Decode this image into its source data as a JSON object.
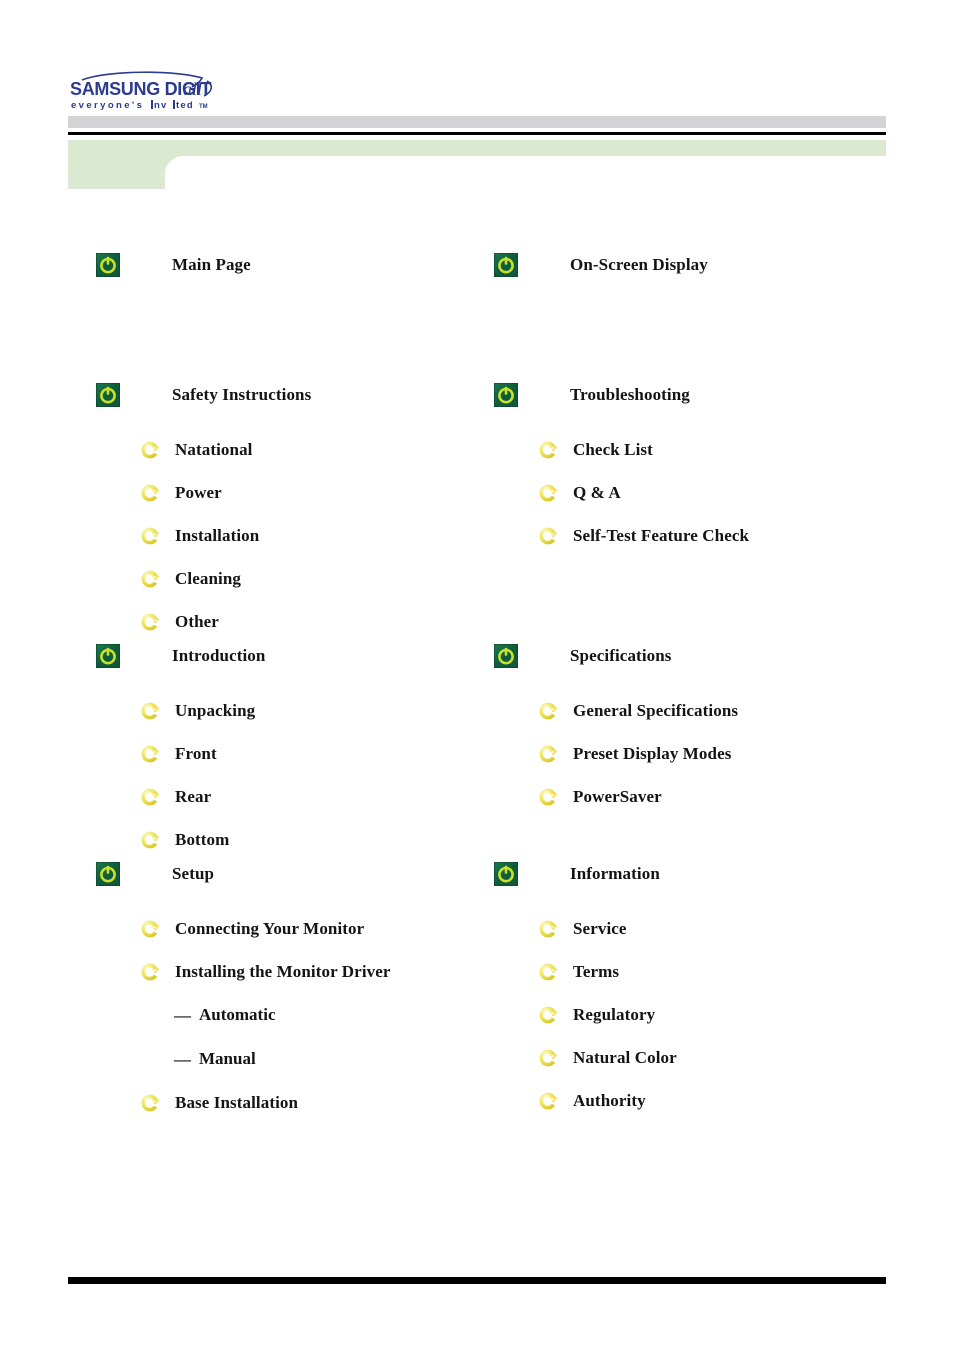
{
  "header": {
    "logo": {
      "name": "samsung-digitall-logo",
      "line1_a": "S",
      "line1_b": "AMSUNG DIGIT",
      "line1_c": "all",
      "line2": "everyone's",
      "line3": "nvited",
      "trademark": "TM"
    },
    "colors": {
      "logo_blue": "#2b3b8f",
      "gray_bar": "#d4d4d6",
      "rule_black": "#000000",
      "banner_green": "#dbe8d2"
    }
  },
  "icons": {
    "power": "power-button-icon",
    "arrow": "circle-arrow-icon",
    "dash": "—"
  },
  "contents": {
    "left": [
      {
        "id": "main-page",
        "label": "Main Page",
        "icon": "power-button-icon",
        "children": []
      },
      {
        "id": "safety-instructions",
        "label": "Safety Instructions",
        "icon": "power-button-icon",
        "children": [
          {
            "id": "natational",
            "label": "Natational",
            "icon": "circle-arrow-icon"
          },
          {
            "id": "power",
            "label": "Power",
            "icon": "circle-arrow-icon"
          },
          {
            "id": "installation",
            "label": "Installation",
            "icon": "circle-arrow-icon"
          },
          {
            "id": "cleaning",
            "label": "Cleaning",
            "icon": "circle-arrow-icon"
          },
          {
            "id": "other",
            "label": "Other",
            "icon": "circle-arrow-icon"
          }
        ]
      },
      {
        "id": "introduction",
        "label": "Introduction",
        "icon": "power-button-icon",
        "children": [
          {
            "id": "unpacking",
            "label": "Unpacking",
            "icon": "circle-arrow-icon"
          },
          {
            "id": "front",
            "label": "Front",
            "icon": "circle-arrow-icon"
          },
          {
            "id": "rear",
            "label": "Rear",
            "icon": "circle-arrow-icon"
          },
          {
            "id": "bottom",
            "label": "Bottom",
            "icon": "circle-arrow-icon"
          }
        ]
      },
      {
        "id": "setup",
        "label": "Setup",
        "icon": "power-button-icon",
        "children": [
          {
            "id": "connecting-your-monitor",
            "label": "Connecting Your Monitor",
            "icon": "circle-arrow-icon"
          },
          {
            "id": "installing-the-monitor-driver",
            "label": "Installing the Monitor Driver",
            "icon": "circle-arrow-icon",
            "children": [
              {
                "id": "automatic",
                "label": "Automatic"
              },
              {
                "id": "manual",
                "label": "Manual"
              }
            ]
          },
          {
            "id": "base-installation",
            "label": "Base Installation",
            "icon": "circle-arrow-icon"
          }
        ]
      }
    ],
    "right": [
      {
        "id": "on-screen-display",
        "label": "On-Screen Display",
        "icon": "power-button-icon",
        "children": []
      },
      {
        "id": "troubleshooting",
        "label": "Troubleshooting",
        "icon": "power-button-icon",
        "children": [
          {
            "id": "check-list",
            "label": "Check List",
            "icon": "circle-arrow-icon"
          },
          {
            "id": "q-and-a",
            "label": "Q & A",
            "icon": "circle-arrow-icon"
          },
          {
            "id": "self-test-feature-check",
            "label": "Self-Test Feature Check",
            "icon": "circle-arrow-icon"
          }
        ]
      },
      {
        "id": "specifications",
        "label": "Specifications",
        "icon": "power-button-icon",
        "children": [
          {
            "id": "general-specifications",
            "label": "General Specifications",
            "icon": "circle-arrow-icon"
          },
          {
            "id": "preset-display-modes",
            "label": "Preset Display Modes",
            "icon": "circle-arrow-icon"
          },
          {
            "id": "powersaver",
            "label": "PowerSaver",
            "icon": "circle-arrow-icon"
          }
        ]
      },
      {
        "id": "information",
        "label": "Information",
        "icon": "power-button-icon",
        "children": [
          {
            "id": "service",
            "label": "Service",
            "icon": "circle-arrow-icon"
          },
          {
            "id": "terms",
            "label": "Terms",
            "icon": "circle-arrow-icon"
          },
          {
            "id": "regulatory",
            "label": "Regulatory",
            "icon": "circle-arrow-icon"
          },
          {
            "id": "natural-color",
            "label": "Natural Color",
            "icon": "circle-arrow-icon"
          },
          {
            "id": "authority",
            "label": "Authority",
            "icon": "circle-arrow-icon"
          }
        ]
      }
    ]
  }
}
